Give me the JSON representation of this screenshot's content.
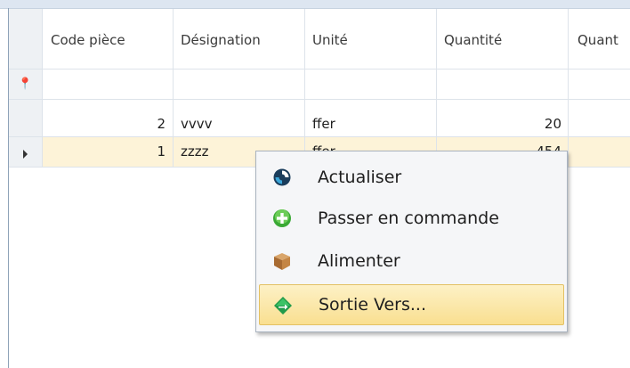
{
  "grid": {
    "columns": [
      "Code pièce",
      "Désignation",
      "Unité",
      "Quantité",
      "Quant"
    ],
    "filter_row_icon": "pin-icon",
    "rows": [
      {
        "code": "2",
        "designation": "vvvv",
        "unite": "ffer",
        "quantite": "20",
        "quant2": ""
      },
      {
        "code": "1",
        "designation": "zzzz",
        "unite": "ffer",
        "quantite": "454",
        "quant2": "",
        "selected": true
      }
    ]
  },
  "context_menu": {
    "items": [
      {
        "label": "Actualiser",
        "icon": "refresh-icon"
      },
      {
        "label": "Passer en commande",
        "icon": "add-icon"
      },
      {
        "label": "Alimenter",
        "icon": "box-icon"
      },
      {
        "label": "Sortie Vers...",
        "icon": "export-arrow-icon",
        "highlighted": true
      }
    ]
  },
  "colors": {
    "selected_row": "#fdf3d8",
    "menu_highlight": "#f9df90",
    "header_strip": "#dde6f1"
  }
}
